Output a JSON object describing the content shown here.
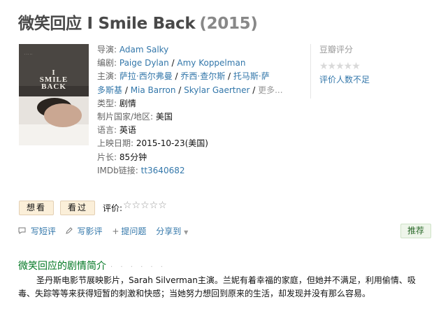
{
  "title": {
    "main": "微笑回应 I Smile Back",
    "year": "(2015)"
  },
  "poster": {
    "title_line1": "I",
    "title_line2": "SMILE",
    "title_line3": "BACK"
  },
  "info": {
    "director": {
      "label": "导演:",
      "value": "Adam Salky"
    },
    "writer": {
      "label": "编剧:",
      "v1": "Paige Dylan",
      "sep": " / ",
      "v2": "Amy Koppelman"
    },
    "cast": {
      "label": "主演:",
      "a1": "萨拉·西尔弗曼",
      "a2": "乔西·查尔斯",
      "a3": "托马斯·萨多斯基",
      "a4": "Mia Barron",
      "a5": "Skylar Gaertner",
      "more": "更多..."
    },
    "genre": {
      "label": "类型:",
      "value": "剧情"
    },
    "country": {
      "label": "制片国家/地区:",
      "value": "美国"
    },
    "language": {
      "label": "语言:",
      "value": "英语"
    },
    "release": {
      "label": "上映日期:",
      "value": "2015-10-23(美国)"
    },
    "runtime": {
      "label": "片长:",
      "value": "85分钟"
    },
    "imdb": {
      "label": "IMDb链接:",
      "value": "tt3640682"
    }
  },
  "rating": {
    "title": "豆瓣评分",
    "stars": "★★★★★",
    "note": "评价人数不足"
  },
  "buttons": {
    "want": "想看",
    "seen": "看过"
  },
  "rate": {
    "label": "评价:",
    "stars": "☆☆☆☆☆"
  },
  "actions": {
    "short_review": {
      "icon": "speech-bubble-icon",
      "label": "写短评"
    },
    "review": {
      "icon": "pencil-icon",
      "label": "写影评"
    },
    "question": {
      "icon": "plus-icon",
      "label": "提问题"
    },
    "share": {
      "label": "分享到",
      "caret": "▼"
    }
  },
  "recommend": "推荐",
  "summary": {
    "title": "微笑回应的剧情简介",
    "dots": "· · · · · ·",
    "text": "圣丹斯电影节展映影片，Sarah Silverman主演。兰妮有着幸福的家庭，但她并不满足，利用偷情、吸毒、失踪等等来获得短暂的刺激和快感；当她努力想回到原来的生活，却发现并没有那么容易。"
  },
  "colors": {
    "link": "#3377aa",
    "section_title": "#007722",
    "button_bg": "#fbefd9"
  }
}
